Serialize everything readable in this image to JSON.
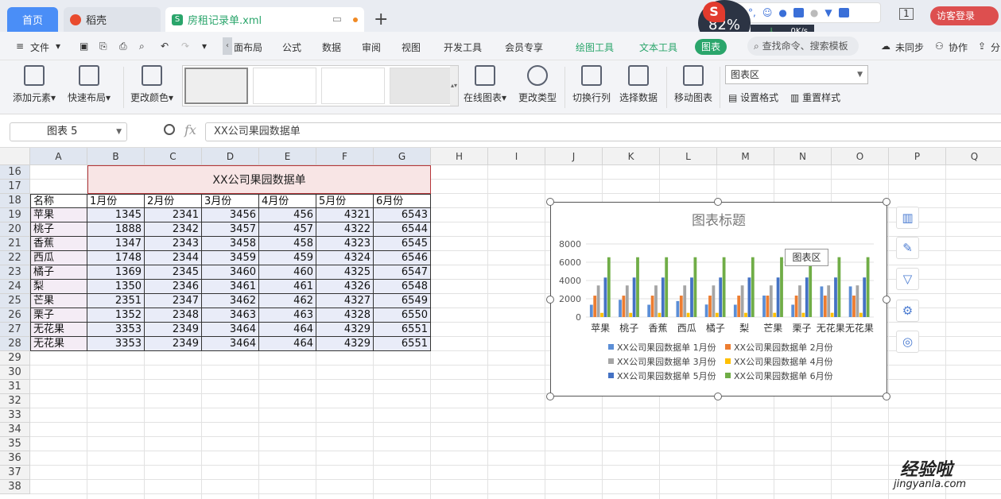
{
  "tabs": {
    "home": "首页",
    "docer": "稻壳",
    "file": "房租记录单.xml"
  },
  "topbar": {
    "gauge_value": "82%",
    "speed": "0K/s",
    "ime_mode": "中",
    "login": "访客登录",
    "window_count": "1"
  },
  "menu": {
    "file": "文件",
    "items": [
      "面布局",
      "公式",
      "数据",
      "审阅",
      "视图",
      "开发工具",
      "会员专享",
      "绘图工具",
      "文本工具",
      "图表"
    ],
    "search": "查找命令、搜索模板",
    "sync": "未同步",
    "collab": "协作",
    "share": "分"
  },
  "ribbon": {
    "add_element": "添加元素",
    "quick_layout": "快速布局",
    "change_color": "更改颜色",
    "online_chart": "在线图表",
    "change_type": "更改类型",
    "switch_rowcol": "切换行列",
    "select_data": "选择数据",
    "move_chart": "移动图表",
    "area_select": "图表区",
    "set_format": "设置格式",
    "reset_style": "重置样式"
  },
  "formula_bar": {
    "name_box": "图表 5",
    "fx": "fx",
    "content": "XX公司果园数据单"
  },
  "columns": [
    "A",
    "B",
    "C",
    "D",
    "E",
    "F",
    "G",
    "H",
    "I",
    "J",
    "K",
    "L",
    "M",
    "N",
    "O",
    "P",
    "Q"
  ],
  "rows": [
    "16",
    "17",
    "18",
    "19",
    "20",
    "21",
    "22",
    "23",
    "24",
    "25",
    "26",
    "27",
    "28",
    "29",
    "30",
    "31",
    "32",
    "33",
    "34",
    "35",
    "36",
    "37",
    "38"
  ],
  "table": {
    "title": "XX公司果园数据单",
    "headers": [
      "名称",
      "1月份",
      "2月份",
      "3月份",
      "4月份",
      "5月份",
      "6月份"
    ],
    "rows": [
      {
        "name": "苹果",
        "values": [
          "1345",
          "2341",
          "3456",
          "456",
          "4321",
          "6543"
        ]
      },
      {
        "name": "桃子",
        "values": [
          "1888",
          "2342",
          "3457",
          "457",
          "4322",
          "6544"
        ]
      },
      {
        "name": "香蕉",
        "values": [
          "1347",
          "2343",
          "3458",
          "458",
          "4323",
          "6545"
        ]
      },
      {
        "name": "西瓜",
        "values": [
          "1748",
          "2344",
          "3459",
          "459",
          "4324",
          "6546"
        ]
      },
      {
        "name": "橘子",
        "values": [
          "1369",
          "2345",
          "3460",
          "460",
          "4325",
          "6547"
        ]
      },
      {
        "name": "梨",
        "values": [
          "1350",
          "2346",
          "3461",
          "461",
          "4326",
          "6548"
        ]
      },
      {
        "name": "芒果",
        "values": [
          "2351",
          "2347",
          "3462",
          "462",
          "4327",
          "6549"
        ]
      },
      {
        "name": "栗子",
        "values": [
          "1352",
          "2348",
          "3463",
          "463",
          "4328",
          "6550"
        ]
      },
      {
        "name": "无花果",
        "values": [
          "3353",
          "2349",
          "3464",
          "464",
          "4329",
          "6551"
        ]
      },
      {
        "name": "无花果",
        "values": [
          "3353",
          "2349",
          "3464",
          "464",
          "4329",
          "6551"
        ]
      }
    ]
  },
  "chart_tooltip": "图表区",
  "colors": {
    "s1": "#5b8ed6",
    "s2": "#ed7d31",
    "s3": "#a5a5a5",
    "s4": "#ffc000",
    "s5": "#4472c4",
    "s6": "#70ad47"
  },
  "chart_data": {
    "type": "bar",
    "title": "图表标题",
    "categories": [
      "苹果",
      "桃子",
      "香蕉",
      "西瓜",
      "橘子",
      "梨",
      "芒果",
      "栗子",
      "无花果",
      "无花果"
    ],
    "ylim": [
      0,
      8000
    ],
    "yticks": [
      "0",
      "2000",
      "4000",
      "6000",
      "8000"
    ],
    "grid": true,
    "legend": "bottom",
    "series": [
      {
        "name": "XX公司果园数据单 1月份",
        "values": [
          1345,
          1888,
          1347,
          1748,
          1369,
          1350,
          2351,
          1352,
          3353,
          3353
        ]
      },
      {
        "name": "XX公司果园数据单 2月份",
        "values": [
          2341,
          2342,
          2343,
          2344,
          2345,
          2346,
          2347,
          2348,
          2349,
          2349
        ]
      },
      {
        "name": "XX公司果园数据单 3月份",
        "values": [
          3456,
          3457,
          3458,
          3459,
          3460,
          3461,
          3462,
          3463,
          3464,
          3464
        ]
      },
      {
        "name": "XX公司果园数据单 4月份",
        "values": [
          456,
          457,
          458,
          459,
          460,
          461,
          462,
          463,
          464,
          464
        ]
      },
      {
        "name": "XX公司果园数据单 5月份",
        "values": [
          4321,
          4322,
          4323,
          4324,
          4325,
          4326,
          4327,
          4328,
          4329,
          4329
        ]
      },
      {
        "name": "XX公司果园数据单 6月份",
        "values": [
          6543,
          6544,
          6545,
          6546,
          6547,
          6548,
          6549,
          6550,
          6551,
          6551
        ]
      }
    ]
  },
  "watermark": {
    "main": "经验啦",
    "sub": "jingyanla.com"
  }
}
